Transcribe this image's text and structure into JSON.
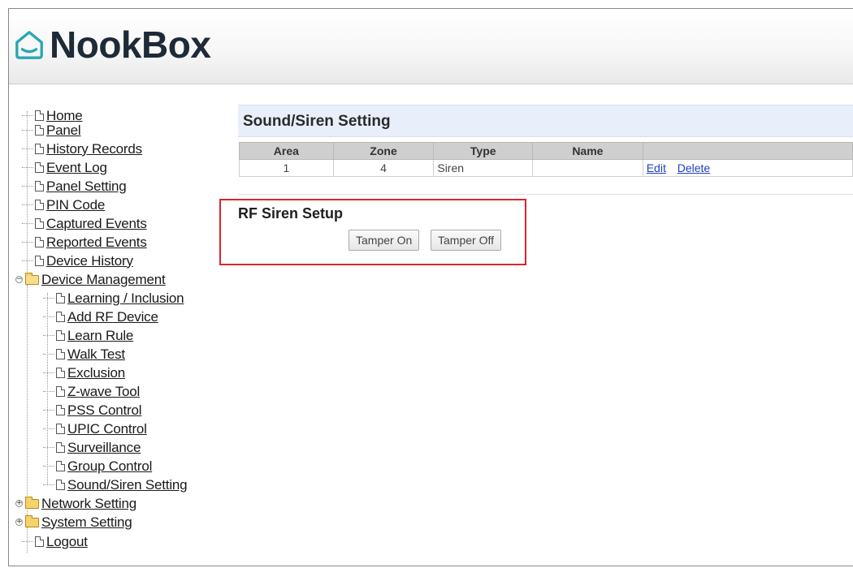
{
  "app": {
    "logo_text": "NookBox",
    "brand_color": "#2aa6b4"
  },
  "nav": {
    "top_items": [
      "Home",
      "Panel",
      "History Records",
      "Event Log",
      "Panel Setting",
      "PIN Code",
      "Captured Events",
      "Reported Events",
      "Device History"
    ],
    "device_management": {
      "label": "Device Management",
      "expanded": true,
      "children": [
        "Learning / Inclusion",
        "Add RF Device",
        "Learn Rule",
        "Walk Test",
        "Exclusion",
        "Z-wave Tool",
        "PSS Control",
        "UPIC Control",
        "Surveillance",
        "Group Control",
        "Sound/Siren Setting"
      ]
    },
    "network_setting": {
      "label": "Network Setting",
      "expanded": false
    },
    "system_setting": {
      "label": "System Setting",
      "expanded": false
    },
    "logout": "Logout"
  },
  "main": {
    "section_title": "Sound/Siren Setting",
    "table": {
      "headers": [
        "Area",
        "Zone",
        "Type",
        "Name",
        ""
      ],
      "rows": [
        {
          "area": "1",
          "zone": "4",
          "type": "Siren",
          "name": "",
          "edit": "Edit",
          "delete": "Delete"
        }
      ]
    },
    "rf_setup": {
      "title": "RF Siren Setup",
      "tamper_on": "Tamper On",
      "tamper_off": "Tamper Off",
      "highlight_color": "#d9262a"
    }
  }
}
